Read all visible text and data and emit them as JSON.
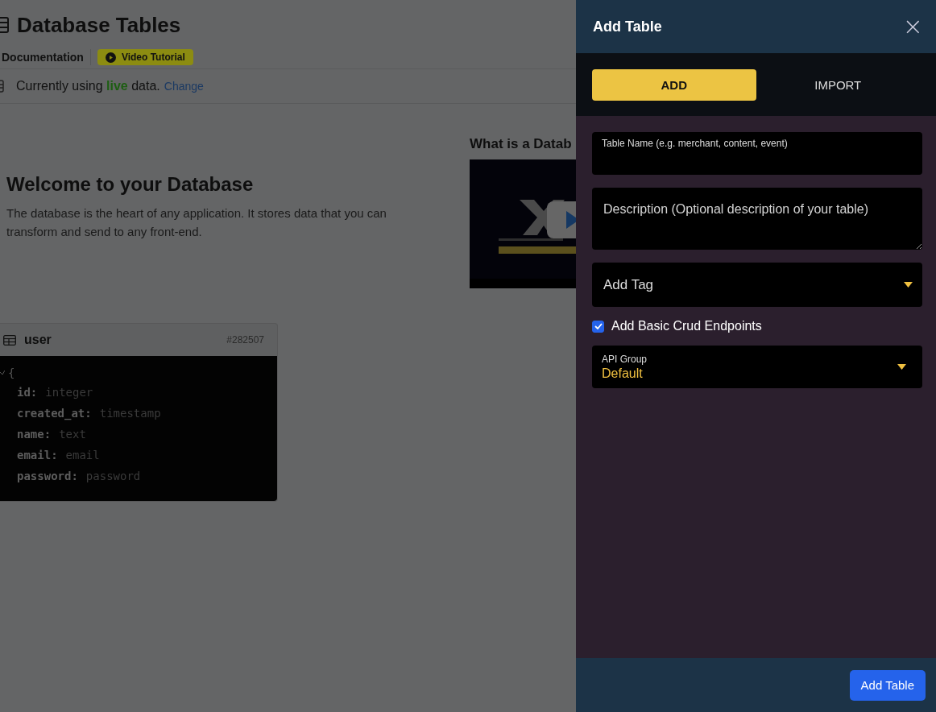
{
  "page": {
    "title": "Database Tables",
    "links": [
      {
        "kind": "link",
        "label": "Documentation"
      },
      {
        "kind": "badge",
        "label": "Video Tutorial"
      }
    ],
    "data_notice": {
      "before": "Currently using",
      "mode": "live",
      "after": "data.",
      "action": "Change"
    },
    "welcome": {
      "heading": "Welcome to your Database",
      "text": "The database is the heart of any application. It stores data that you can transform and send to any front-end."
    },
    "video": {
      "heading": "What is a Datab",
      "kind": "picture"
    },
    "table_card": {
      "name": "user",
      "id": "#282507",
      "open_brace": "{",
      "fields": [
        {
          "key": "id:",
          "type": "integer"
        },
        {
          "key": "created_at:",
          "type": "timestamp"
        },
        {
          "key": "name:",
          "type": "text"
        },
        {
          "key": "email:",
          "type": "email"
        },
        {
          "key": "password:",
          "type": "password"
        }
      ]
    }
  },
  "drawer": {
    "title": "Add Table",
    "close": "×",
    "tabs": [
      {
        "label": "ADD",
        "selected": true
      },
      {
        "label": "IMPORT",
        "selected": false
      }
    ],
    "table_name": {
      "label": "Table Name (e.g. merchant, content, event)"
    },
    "description": {
      "placeholder": "Description (Optional description of your table)"
    },
    "tag": {
      "placeholder": "Add Tag"
    },
    "crud": {
      "label": "Add Basic Crud Endpoints",
      "checked": true
    },
    "api_group": {
      "label": "API Group",
      "value": "Default"
    },
    "submit": "Add Table"
  }
}
